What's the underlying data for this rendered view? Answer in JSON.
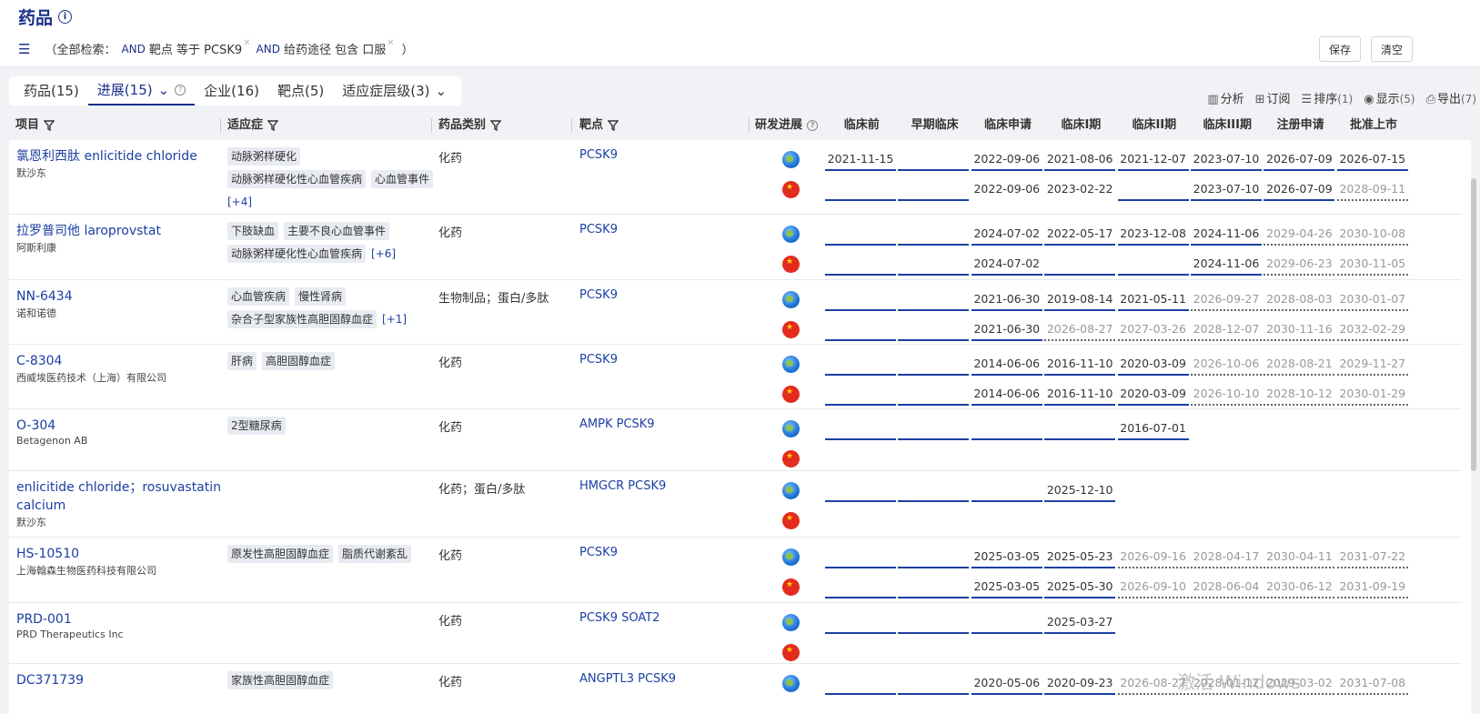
{
  "header": {
    "title": "药品"
  },
  "query": {
    "prefix": "（全部检索：",
    "and1": "AND",
    "c1": "靶点 等于 PCSK9",
    "and2": "AND",
    "c2": "给药途径 包含 口服",
    "suffix": "）"
  },
  "buttons": {
    "save": "保存",
    "clear": "清空"
  },
  "tabs": [
    {
      "label": "药品(15)"
    },
    {
      "label": "进展(15)",
      "active": true
    },
    {
      "label": "企业(16)"
    },
    {
      "label": "靶点(5)"
    },
    {
      "label": "适应症层级(3)"
    }
  ],
  "toolbar": {
    "analyze": "分析",
    "subscribe": "订阅",
    "sort": "排序",
    "sort_count": "(1)",
    "display": "显示",
    "display_count": "(5)",
    "export": "导出",
    "export_count": "(7)"
  },
  "columns": {
    "project": "项目",
    "indication": "适应症",
    "category": "药品类别",
    "target": "靶点",
    "progress": "研发进展",
    "phases": [
      "临床前",
      "早期临床",
      "临床申请",
      "临床I期",
      "临床II期",
      "临床III期",
      "注册申请",
      "批准上市"
    ]
  },
  "rows": [
    {
      "name": "氯恩利西肽 enlicitide chloride",
      "company": "默沙东",
      "tags": [
        "动脉粥样硬化",
        "动脉粥样硬化性心血管疾病",
        "心血管事件"
      ],
      "more": "[+4]",
      "category": "化药",
      "target": "PCSK9",
      "tracks": [
        {
          "region": "global",
          "cells": [
            [
              "2021-11-15",
              "s"
            ],
            [
              "",
              "s"
            ],
            [
              "2022-09-06",
              "s"
            ],
            [
              "2021-08-06",
              "s"
            ],
            [
              "2021-12-07",
              "s"
            ],
            [
              "2023-07-10",
              "s"
            ],
            [
              "2026-07-09",
              "s"
            ],
            [
              "2026-07-15",
              "s"
            ]
          ]
        },
        {
          "region": "china",
          "cells": [
            [
              "",
              "s"
            ],
            [
              "",
              "s"
            ],
            [
              "2022-09-06",
              "n"
            ],
            [
              "2023-02-22",
              "n"
            ],
            [
              "",
              "s"
            ],
            [
              "2023-07-10",
              "s"
            ],
            [
              "2026-07-09",
              "s"
            ],
            [
              "2028-09-11",
              "d"
            ]
          ]
        }
      ]
    },
    {
      "name": "拉罗普司他 laroprovstat",
      "company": "阿斯利康",
      "tags": [
        "下肢缺血",
        "主要不良心血管事件",
        "动脉粥样硬化性心血管疾病"
      ],
      "more": "[+6]",
      "category": "化药",
      "target": "PCSK9",
      "tracks": [
        {
          "region": "global",
          "cells": [
            [
              "",
              "s"
            ],
            [
              "",
              "s"
            ],
            [
              "2024-07-02",
              "s"
            ],
            [
              "2022-05-17",
              "s"
            ],
            [
              "2023-12-08",
              "s"
            ],
            [
              "2024-11-06",
              "s"
            ],
            [
              "2029-04-26",
              "d"
            ],
            [
              "2030-10-08",
              "d"
            ]
          ]
        },
        {
          "region": "china",
          "cells": [
            [
              "",
              "s"
            ],
            [
              "",
              "s"
            ],
            [
              "2024-07-02",
              "s"
            ],
            [
              "",
              "s"
            ],
            [
              "",
              "s"
            ],
            [
              "2024-11-06",
              "s"
            ],
            [
              "2029-06-23",
              "d"
            ],
            [
              "2030-11-05",
              "d"
            ]
          ]
        }
      ]
    },
    {
      "name": "NN-6434",
      "company": "诺和诺德",
      "tags": [
        "心血管疾病",
        "慢性肾病",
        "杂合子型家族性高胆固醇血症"
      ],
      "more": "[+1]",
      "category": "生物制品；蛋白/多肽",
      "target": "PCSK9",
      "tracks": [
        {
          "region": "global",
          "cells": [
            [
              "",
              "s"
            ],
            [
              "",
              "s"
            ],
            [
              "2021-06-30",
              "s"
            ],
            [
              "2019-08-14",
              "s"
            ],
            [
              "2021-05-11",
              "s"
            ],
            [
              "2026-09-27",
              "d"
            ],
            [
              "2028-08-03",
              "d"
            ],
            [
              "2030-01-07",
              "d"
            ]
          ]
        },
        {
          "region": "china",
          "cells": [
            [
              "",
              "s"
            ],
            [
              "",
              "s"
            ],
            [
              "2021-06-30",
              "s"
            ],
            [
              "2026-08-27",
              "d"
            ],
            [
              "2027-03-26",
              "d"
            ],
            [
              "2028-12-07",
              "d"
            ],
            [
              "2030-11-16",
              "d"
            ],
            [
              "2032-02-29",
              "d"
            ]
          ]
        }
      ]
    },
    {
      "name": "C-8304",
      "company": "西威埃医药技术（上海）有限公司",
      "tags": [
        "肝病",
        "高胆固醇血症"
      ],
      "more": "",
      "category": "化药",
      "target": "PCSK9",
      "tracks": [
        {
          "region": "global",
          "cells": [
            [
              "",
              "s"
            ],
            [
              "",
              "s"
            ],
            [
              "2014-06-06",
              "s"
            ],
            [
              "2016-11-10",
              "s"
            ],
            [
              "2020-03-09",
              "s"
            ],
            [
              "2026-10-06",
              "d"
            ],
            [
              "2028-08-21",
              "d"
            ],
            [
              "2029-11-27",
              "d"
            ]
          ]
        },
        {
          "region": "china",
          "cells": [
            [
              "",
              "s"
            ],
            [
              "",
              "s"
            ],
            [
              "2014-06-06",
              "s"
            ],
            [
              "2016-11-10",
              "s"
            ],
            [
              "2020-03-09",
              "s"
            ],
            [
              "2026-10-10",
              "d"
            ],
            [
              "2028-10-12",
              "d"
            ],
            [
              "2030-01-29",
              "d"
            ]
          ]
        }
      ]
    },
    {
      "name": "O-304",
      "company": "Betagenon AB",
      "tags": [
        "2型糖尿病"
      ],
      "more": "",
      "category": "化药",
      "target": "AMPK PCSK9",
      "tracks": [
        {
          "region": "global",
          "cells": [
            [
              "",
              "s"
            ],
            [
              "",
              "s"
            ],
            [
              "",
              "s"
            ],
            [
              "",
              "s"
            ],
            [
              "2016-07-01",
              "s"
            ]
          ]
        },
        {
          "region": "china",
          "cells": []
        }
      ]
    },
    {
      "name": "enlicitide chloride；rosuvastatin calcium",
      "company": "默沙东",
      "tags": [],
      "more": "",
      "category": "化药；蛋白/多肽",
      "target": "HMGCR PCSK9",
      "tracks": [
        {
          "region": "global",
          "cells": [
            [
              "",
              "s"
            ],
            [
              "",
              "s"
            ],
            [
              "",
              "s"
            ],
            [
              "2025-12-10",
              "s"
            ]
          ]
        },
        {
          "region": "china",
          "cells": []
        }
      ]
    },
    {
      "name": "HS-10510",
      "company": "上海翰森生物医药科技有限公司",
      "tags": [
        "原发性高胆固醇血症",
        "脂质代谢紊乱"
      ],
      "more": "",
      "category": "化药",
      "target": "PCSK9",
      "tracks": [
        {
          "region": "global",
          "cells": [
            [
              "",
              "s"
            ],
            [
              "",
              "s"
            ],
            [
              "2025-03-05",
              "s"
            ],
            [
              "2025-05-23",
              "s"
            ],
            [
              "2026-09-16",
              "d"
            ],
            [
              "2028-04-17",
              "d"
            ],
            [
              "2030-04-11",
              "d"
            ],
            [
              "2031-07-22",
              "d"
            ]
          ]
        },
        {
          "region": "china",
          "cells": [
            [
              "",
              "s"
            ],
            [
              "",
              "s"
            ],
            [
              "2025-03-05",
              "s"
            ],
            [
              "2025-05-30",
              "s"
            ],
            [
              "2026-09-10",
              "d"
            ],
            [
              "2028-06-04",
              "d"
            ],
            [
              "2030-06-12",
              "d"
            ],
            [
              "2031-09-19",
              "d"
            ]
          ]
        }
      ]
    },
    {
      "name": "PRD-001",
      "company": "PRD Therapeutics Inc",
      "tags": [],
      "more": "",
      "category": "化药",
      "target": "PCSK9 SOAT2",
      "tracks": [
        {
          "region": "global",
          "cells": [
            [
              "",
              "s"
            ],
            [
              "",
              "s"
            ],
            [
              "",
              "s"
            ],
            [
              "2025-03-27",
              "s"
            ]
          ]
        },
        {
          "region": "china",
          "cells": []
        }
      ]
    },
    {
      "name": "DC371739",
      "company": "",
      "tags": [
        "家族性高胆固醇血症"
      ],
      "more": "",
      "category": "化药",
      "target": "ANGPTL3 PCSK9",
      "tracks": [
        {
          "region": "global",
          "cells": [
            [
              "",
              "s"
            ],
            [
              "",
              "s"
            ],
            [
              "2020-05-06",
              "s"
            ],
            [
              "2020-09-23",
              "s"
            ],
            [
              "2026-08-27",
              "d"
            ],
            [
              "2028-01-12",
              "d"
            ],
            [
              "2029-03-02",
              "d"
            ],
            [
              "2031-07-08",
              "d"
            ]
          ]
        }
      ]
    }
  ],
  "watermark": "激活 Windows"
}
